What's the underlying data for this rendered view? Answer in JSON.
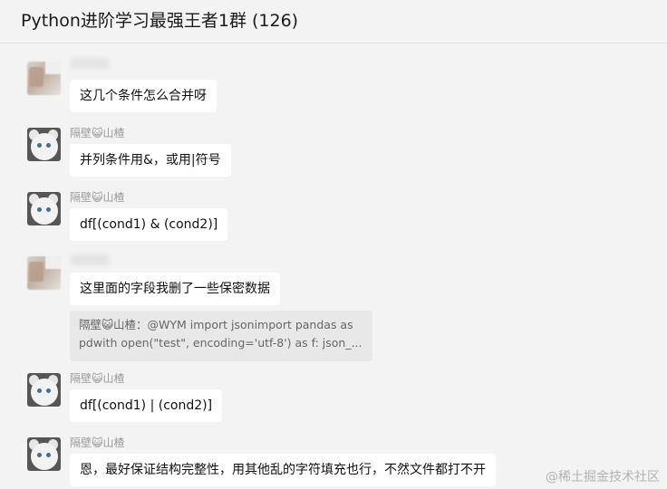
{
  "chat": {
    "title": "Python进阶学习最强王者1群 (126)"
  },
  "messages": [
    {
      "sender": "",
      "text": "这几个条件怎么合并呀"
    },
    {
      "sender": "隔壁😺山楂",
      "text": "并列条件用&，或用|符号"
    },
    {
      "sender": "隔壁😺山楂",
      "text": "df[(cond1) & (cond2)]"
    },
    {
      "sender": "",
      "text": "这里面的字段我删了一些保密数据",
      "quote": {
        "line1": "隔壁😺山楂：@WYM import jsonimport pandas as",
        "line2": "pdwith open(\"test\", encoding='utf-8') as f:    json_..."
      }
    },
    {
      "sender": "隔壁😺山楂",
      "text": "df[(cond1) | (cond2)]"
    },
    {
      "sender": "隔壁😺山楂",
      "text": "恩，最好保证结构完整性，用其他乱的字符填充也行，不然文件都打不开"
    }
  ],
  "watermark": "@稀土掘金技术社区",
  "icons": {
    "blurred_avatar": "blurred-avatar",
    "cat_avatar": "white-cat-avatar"
  }
}
